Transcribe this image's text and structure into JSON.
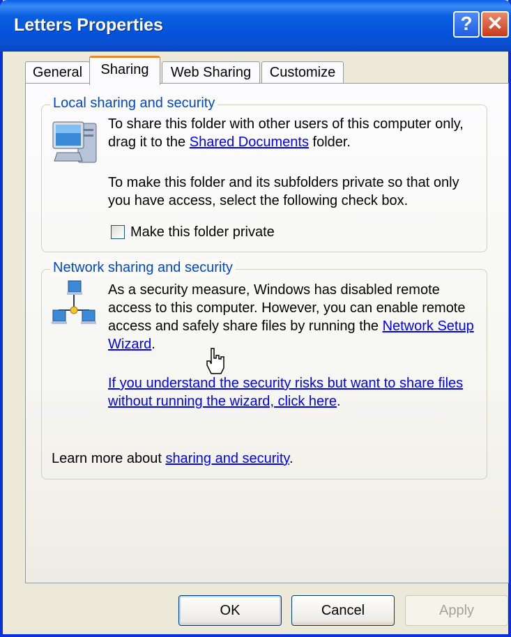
{
  "window": {
    "title": "Letters Properties",
    "help_glyph": "?",
    "close_glyph": "✕"
  },
  "tabs": [
    {
      "label": "General"
    },
    {
      "label": "Sharing"
    },
    {
      "label": "Web Sharing"
    },
    {
      "label": "Customize"
    }
  ],
  "active_tab": "Sharing",
  "local": {
    "legend": "Local sharing and security",
    "p1_before": "To share this folder with other users of this computer only, drag it to the ",
    "p1_link": "Shared Documents",
    "p1_after": " folder.",
    "p2": "To make this folder and its subfolders private so that only you have access, select the following check box.",
    "checkbox_label": "Make this folder private",
    "checkbox_checked": false
  },
  "network": {
    "legend": "Network sharing and security",
    "p1": "As a security measure, Windows has disabled remote access to this computer. However, you can enable remote access and safely share files by running the ",
    "p1_link": "Network Setup Wizard",
    "p1_after": ".",
    "link2": "If you understand the security risks but want to share files without running the wizard, click here",
    "link2_after": ".",
    "learn_before": "Learn more about ",
    "learn_link": "sharing and security",
    "learn_after": "."
  },
  "buttons": {
    "ok": "OK",
    "cancel": "Cancel",
    "apply": "Apply"
  },
  "icons": {
    "computer": "computer-icon",
    "network": "network-icon",
    "cursor": "hand-cursor-icon"
  }
}
